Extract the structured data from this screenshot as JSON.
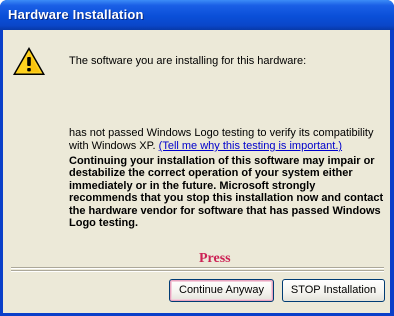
{
  "window": {
    "title": "Hardware Installation"
  },
  "dialog": {
    "icon": "warning-icon",
    "intro": "The software you are installing for this hardware:",
    "logo_text": "has not passed Windows Logo testing to verify its compatibility with Windows XP.",
    "link_text": "(Tell me why this testing is important.)",
    "warning": "Continuing your installation of this software may impair or destabilize the correct operation of your system either immediately or in the future. Microsoft strongly recommends that you stop this installation now and contact the hardware vendor for software that has passed Windows Logo testing.",
    "annotation": "Press"
  },
  "buttons": {
    "continue_label": "Continue Anyway",
    "stop_label": "STOP Installation"
  },
  "colors": {
    "titlebar": "#0a4fd8",
    "dialog_bg": "#ece9d8",
    "link": "#0000cc",
    "annotation": "#cc2255"
  }
}
